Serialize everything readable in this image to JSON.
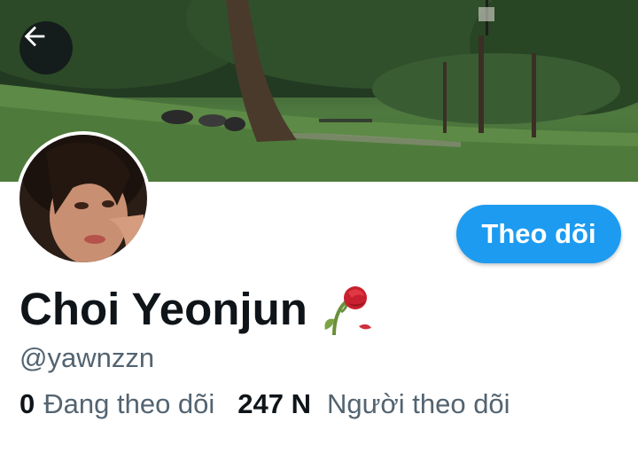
{
  "header": {
    "back_icon": "arrow-left-icon",
    "banner_description_icon": "park-banner-image"
  },
  "profile": {
    "display_name": "Choi Yeonjun",
    "name_emoji_icon": "wilted-rose-icon",
    "handle": "@yawnzzn",
    "follow_button_label": "Theo dõi",
    "avatar_icon": "profile-avatar-image"
  },
  "stats": {
    "following_count": "0",
    "following_label": "Đang theo dõi",
    "followers_count": "247 N",
    "followers_label": "Người theo dõi"
  },
  "colors": {
    "accent": "#1d9bf0",
    "text_primary": "#0f1419",
    "text_secondary": "#536471"
  }
}
